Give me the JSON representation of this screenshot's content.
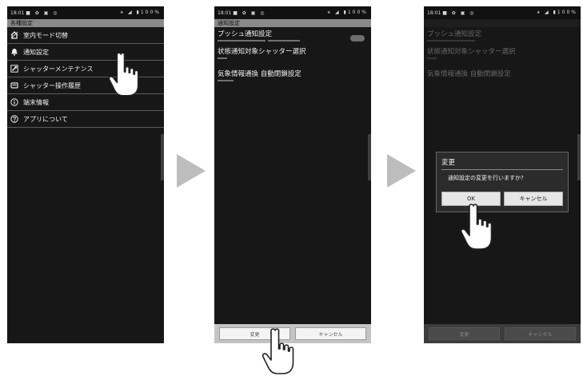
{
  "colors": {
    "screen_bg": "#171717",
    "header_bar": "#8a8a8a",
    "arrow": "#bdbdbd",
    "dialog_bg": "#2b2b2b"
  },
  "screen1": {
    "status": {
      "time": "18:01",
      "icons_left": "■ ✿ ▣ ◎",
      "icons_right": "⚹ ◢ ▮100%"
    },
    "header": "各種設定",
    "items": [
      {
        "label": "室内モード切替",
        "icon": "house-mode-icon"
      },
      {
        "label": "通知設定",
        "icon": "bell-icon"
      },
      {
        "label": "シャッターメンテナンス",
        "icon": "wrench-icon"
      },
      {
        "label": "シャッター操作履歴",
        "icon": "history-icon"
      },
      {
        "label": "端末情報",
        "icon": "info-icon"
      },
      {
        "label": "アプリについて",
        "icon": "question-icon"
      }
    ]
  },
  "screen2": {
    "status": {
      "time": "18:01",
      "icons_left": "■ ✿ ▣ ◎",
      "icons_right": "⚹ ◢ ▮100%"
    },
    "header": "通知設定",
    "settings": [
      {
        "label": "プッシュ通知設定"
      },
      {
        "label": "状態通知対象シャッター選択"
      },
      {
        "label": "気象情報通換 自動閉鎖設定"
      }
    ],
    "bottom_buttons": [
      "変更",
      "キャンセル"
    ]
  },
  "screen3": {
    "status": {
      "time": "18:01",
      "icons_left": "■ ✿ ▣ ◎",
      "icons_right": "⚹ ◢ ▮100%"
    },
    "settings": [
      {
        "label": "プッシュ通知設定"
      },
      {
        "label": "状態通知対象シャッター選択"
      },
      {
        "label": "気象情報通換 自動閉鎖設定"
      }
    ],
    "dialog": {
      "title": "変更",
      "message": "通知設定の変更を行いますか?",
      "ok": "OK",
      "cancel": "キャンセル"
    },
    "bottom_buttons": [
      "変更",
      "キャンセル"
    ]
  }
}
